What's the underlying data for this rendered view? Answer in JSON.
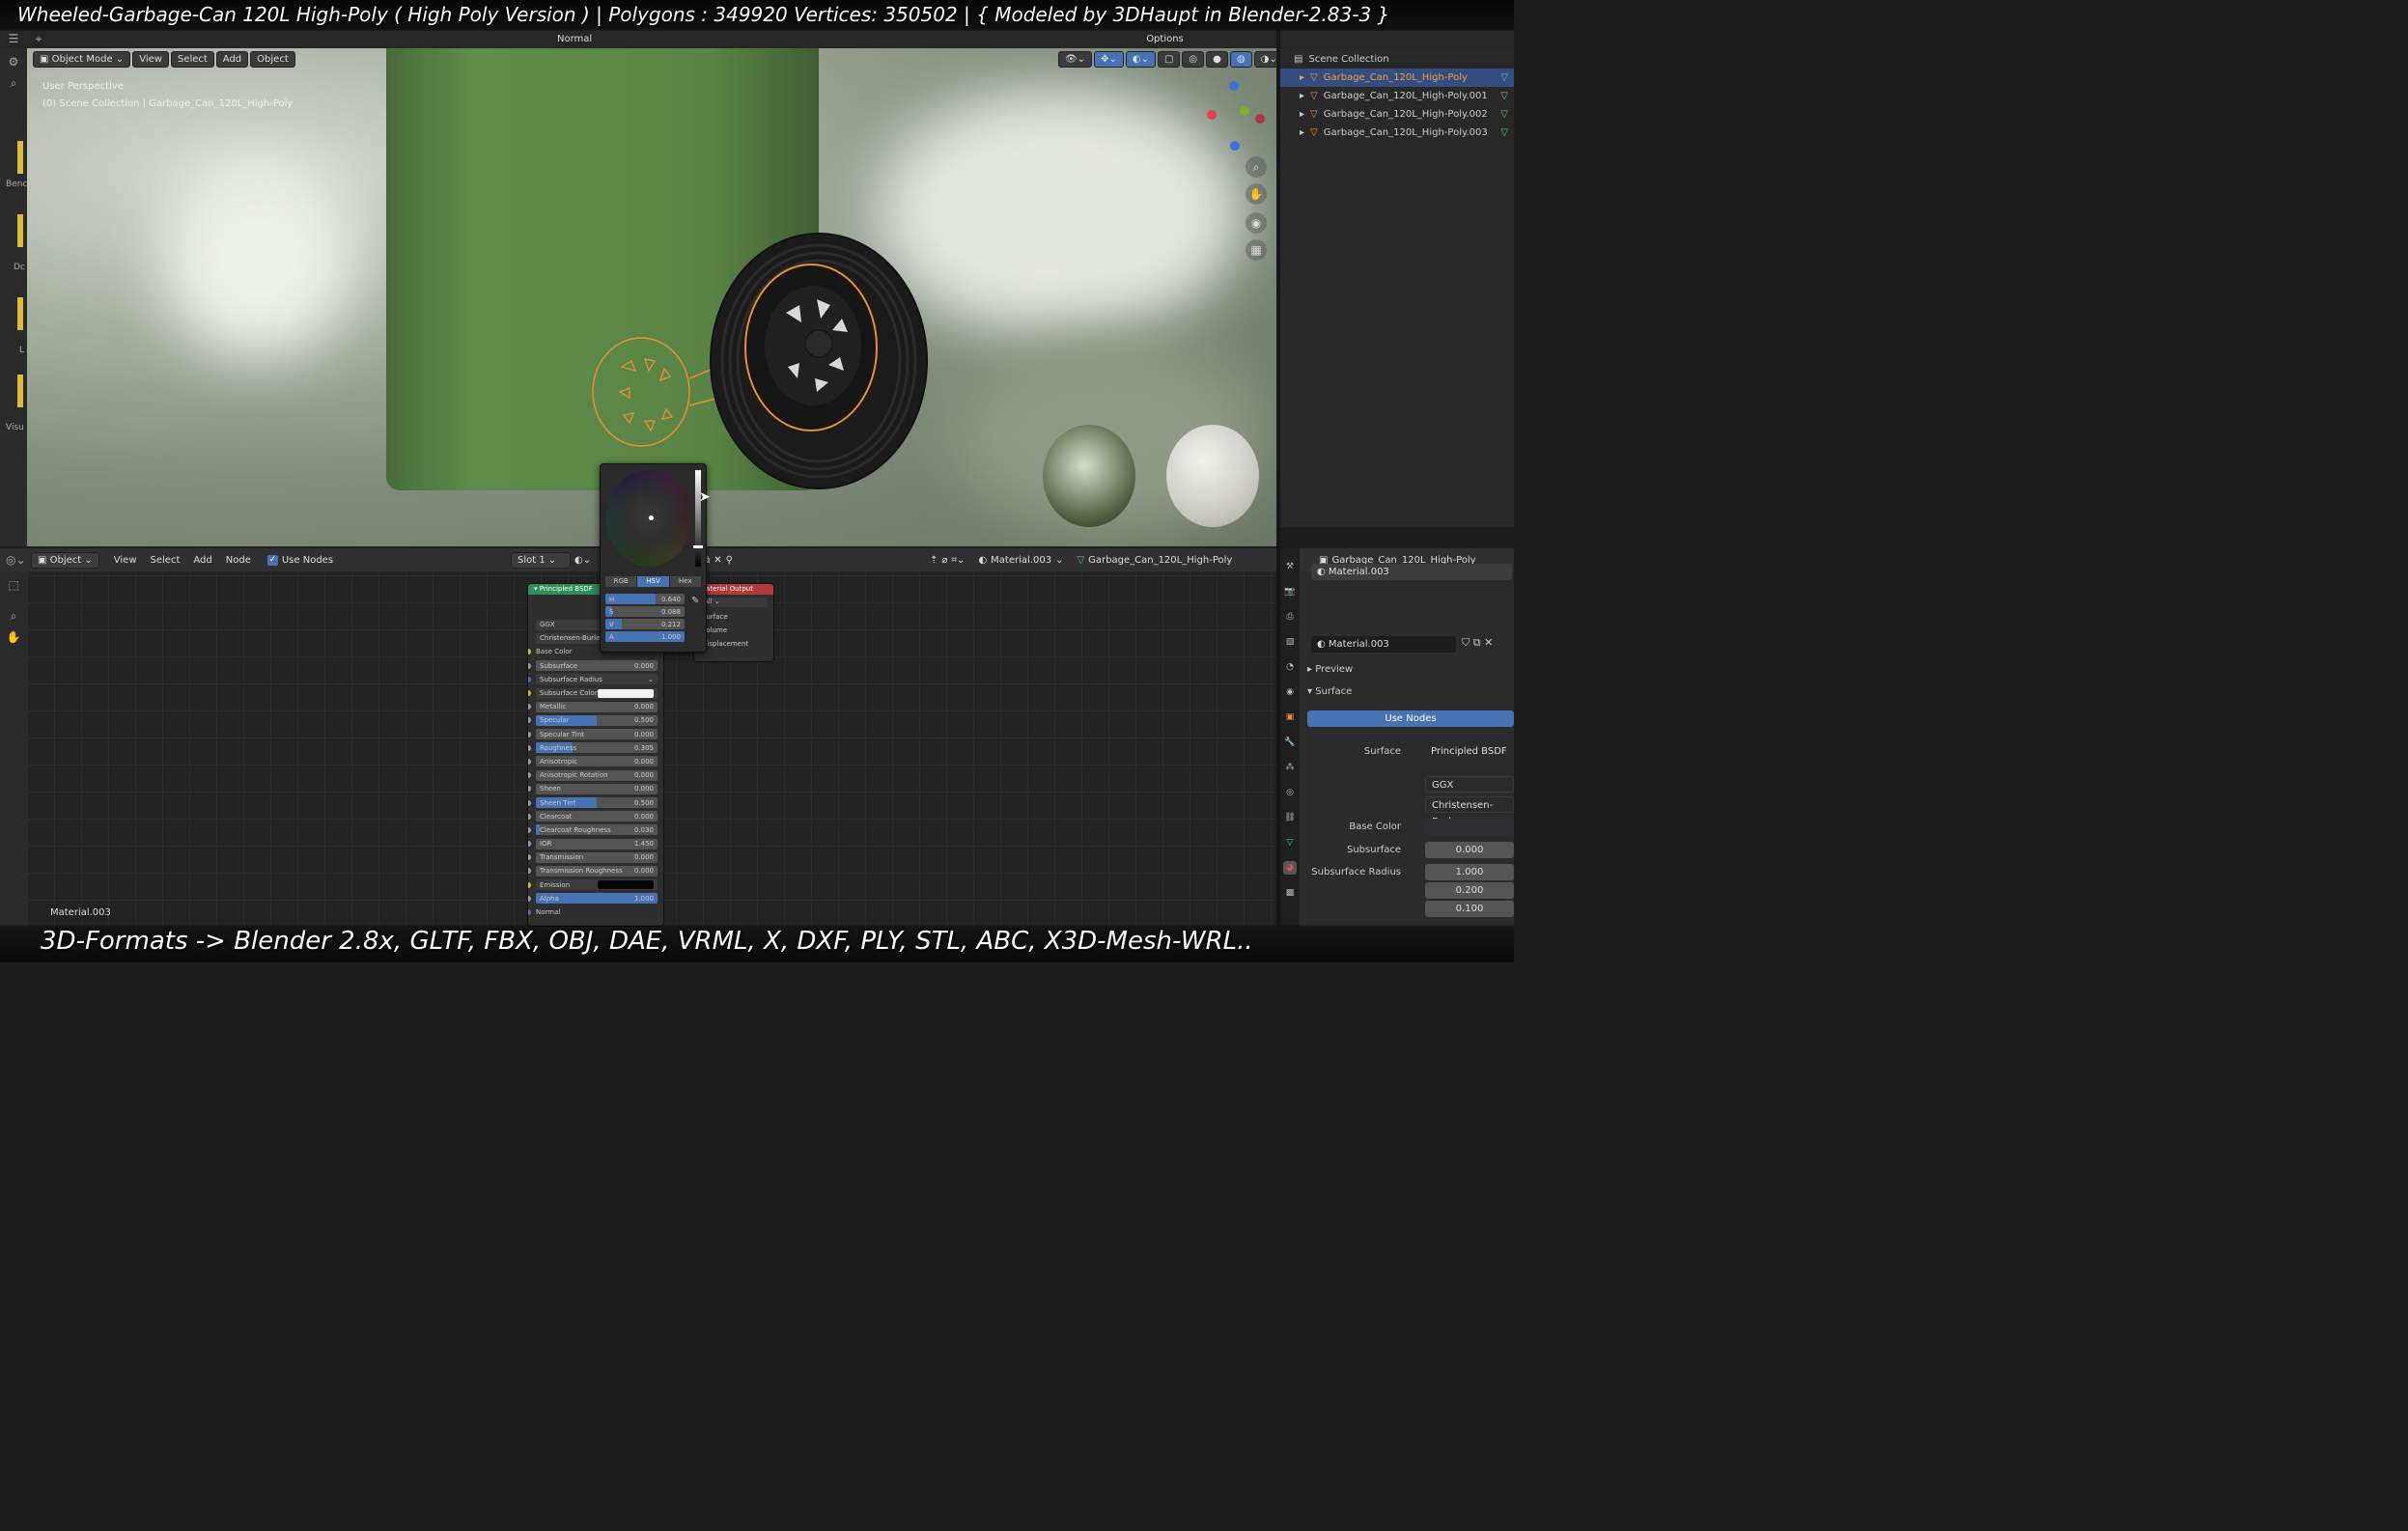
{
  "captions": {
    "top": "Wheeled-Garbage-Can 120L High-Poly ( High Poly Version )  |   Polygons : 349920   Vertices: 350502     |     { Modeled by 3DHaupt in Blender-2.83-3 }",
    "bottom": "3D-Formats -> Blender 2.8x, GLTF, FBX, OBJ, DAE, VRML, X, DXF, PLY, STL, ABC, X3D-Mesh-WRL.."
  },
  "top_header": {
    "transform": "Normal",
    "options": "Options"
  },
  "viewport": {
    "mode": "Object Mode",
    "menus": [
      "View",
      "Select",
      "Add",
      "Object"
    ],
    "perspective": "User Perspective",
    "collection_path": "(0) Scene Collection | Garbage_Can_120L_High-Poly"
  },
  "left_toolbar": {
    "labels": [
      "Benc",
      "Dc",
      "L",
      "Visu"
    ]
  },
  "outliner": {
    "root": "Scene Collection",
    "items": [
      {
        "label": "Garbage_Can_120L_High-Poly",
        "selected": true
      },
      {
        "label": "Garbage_Can_120L_High-Poly.001",
        "selected": false
      },
      {
        "label": "Garbage_Can_120L_High-Poly.002",
        "selected": false
      },
      {
        "label": "Garbage_Can_120L_High-Poly.003",
        "selected": false
      }
    ]
  },
  "node_editor": {
    "type": "Object",
    "menus": [
      "View",
      "Select",
      "Add",
      "Node"
    ],
    "use_nodes": "Use Nodes",
    "slot": "Slot 1",
    "material": "Material.003",
    "object": "Garbage_Can_120L_High-Poly",
    "footer_material": "Material.003",
    "bsdf": {
      "title": "Principled BSDF",
      "distribution": "GGX",
      "subsurface_method": "Christensen-Burley",
      "rows": [
        {
          "label": "Base Color",
          "value": "",
          "kind": "color",
          "socket": "y"
        },
        {
          "label": "Subsurface",
          "value": "0.000",
          "fill": 0,
          "socket": "g"
        },
        {
          "label": "Subsurface Radius",
          "value": "",
          "kind": "dropdown",
          "socket": "p"
        },
        {
          "label": "Subsurface Color",
          "value": "",
          "kind": "white",
          "socket": "y"
        },
        {
          "label": "Metallic",
          "value": "0.000",
          "fill": 0,
          "socket": "g"
        },
        {
          "label": "Specular",
          "value": "0.500",
          "fill": 0.5,
          "socket": "g"
        },
        {
          "label": "Specular Tint",
          "value": "0.000",
          "fill": 0,
          "socket": "g"
        },
        {
          "label": "Roughness",
          "value": "0.305",
          "fill": 0.305,
          "socket": "g"
        },
        {
          "label": "Anisotropic",
          "value": "0.000",
          "fill": 0,
          "socket": "g"
        },
        {
          "label": "Anisotropic Rotation",
          "value": "0.000",
          "fill": 0,
          "socket": "g"
        },
        {
          "label": "Sheen",
          "value": "0.000",
          "fill": 0,
          "socket": "g"
        },
        {
          "label": "Sheen Tint",
          "value": "0.500",
          "fill": 0.5,
          "socket": "g"
        },
        {
          "label": "Clearcoat",
          "value": "0.000",
          "fill": 0,
          "socket": "g"
        },
        {
          "label": "Clearcoat Roughness",
          "value": "0.030",
          "fill": 0.03,
          "socket": "g"
        },
        {
          "label": "IOR",
          "value": "1.450",
          "fill": 0,
          "socket": "g"
        },
        {
          "label": "Transmission",
          "value": "0.000",
          "fill": 0,
          "socket": "g"
        },
        {
          "label": "Transmission Roughness",
          "value": "0.000",
          "fill": 0,
          "socket": "g"
        },
        {
          "label": "Emission",
          "value": "",
          "kind": "black",
          "socket": "y"
        },
        {
          "label": "Alpha",
          "value": "1.000",
          "fill": 1,
          "socket": "g"
        },
        {
          "label": "Normal",
          "value": "",
          "kind": "label",
          "socket": "p"
        }
      ]
    },
    "output": {
      "title": "Material Output",
      "target": "All",
      "sockets": [
        "Surface",
        "Volume",
        "Displacement"
      ]
    }
  },
  "color_picker": {
    "tabs": [
      "RGB",
      "HSV",
      "Hex"
    ],
    "active_tab": "HSV",
    "fields": [
      {
        "label": "H",
        "value": "0.640",
        "fill": 0.64
      },
      {
        "label": "S",
        "value": "0.088",
        "fill": 0.088
      },
      {
        "label": "V",
        "value": "0.212",
        "fill": 0.212
      },
      {
        "label": "A",
        "value": "1.000",
        "fill": 1
      }
    ]
  },
  "properties": {
    "object": "Garbage_Can_120L_High-Poly",
    "material_slot": "Material.003",
    "material": "Material.003",
    "preview": "Preview",
    "surface_panel": "Surface",
    "use_nodes": "Use Nodes",
    "surface_label": "Surface",
    "surface_value": "Principled BSDF",
    "distribution": "GGX",
    "subsurface_method": "Christensen-Burley",
    "base_color_label": "Base Color",
    "subsurface_label": "Subsurface",
    "subsurface_value": "0.000",
    "radius_label": "Subsurface Radius",
    "radius_values": [
      "1.000",
      "0.200",
      "0.100"
    ]
  },
  "colors": {
    "accent_blue": "#4772b3",
    "selection_orange": "#f0a13a",
    "can_green": "#5a8445",
    "bsdf_header": "#2f8f5b",
    "output_header": "#b33a3a"
  }
}
